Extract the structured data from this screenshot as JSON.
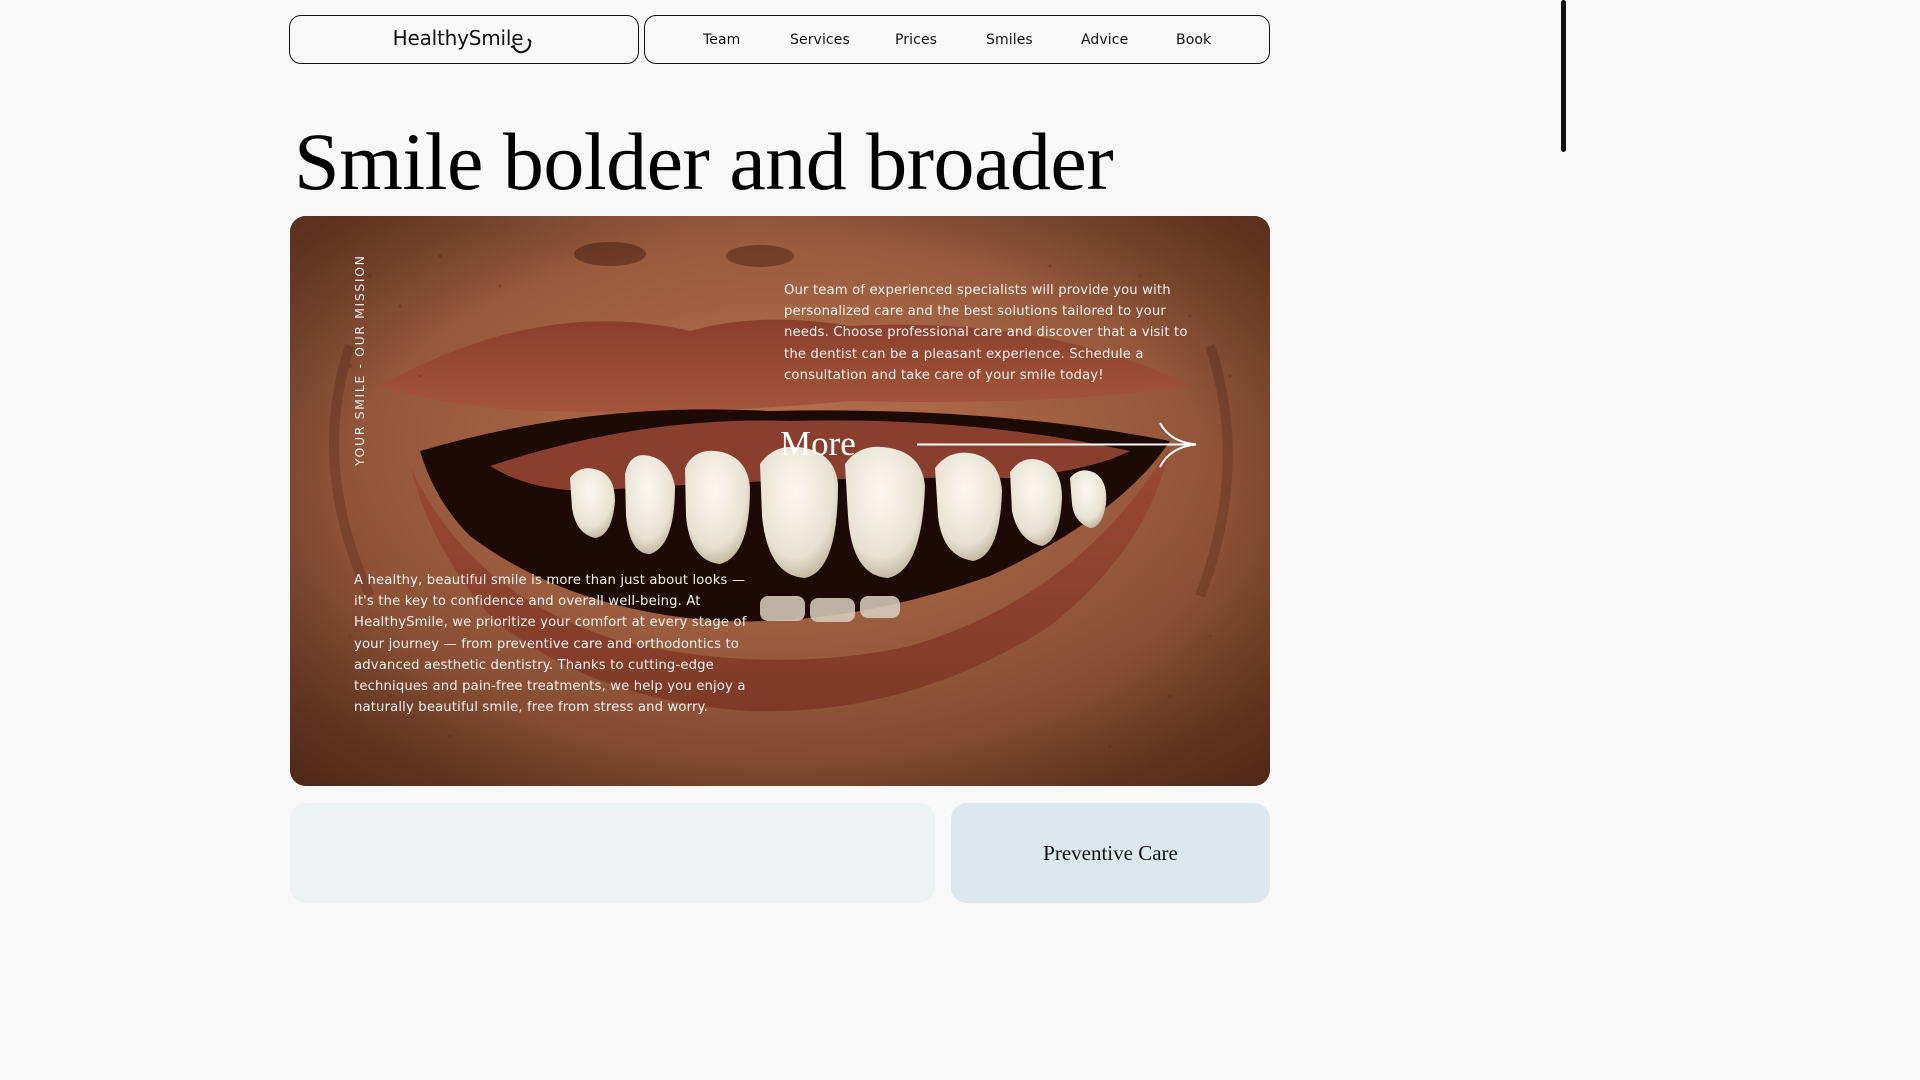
{
  "header": {
    "logo_text": "HealthySmile",
    "nav": [
      {
        "label": "Team"
      },
      {
        "label": "Services"
      },
      {
        "label": "Prices"
      },
      {
        "label": "Smiles"
      },
      {
        "label": "Advice"
      },
      {
        "label": "Book"
      }
    ]
  },
  "hero": {
    "title": "Smile bolder and broader",
    "mission_label": "YOUR SMILE - OUR MISSION",
    "text_right": "Our team of experienced specialists will provide you with personalized care and the best solutions tailored to your needs. Choose professional care and discover that a visit to the dentist can be a pleasant experience. Schedule a consultation and take care of your smile today!",
    "text_left": "A healthy, beautiful smile is more than just about looks — it's the key to confidence and overall well-being. At HealthySmile, we prioritize your comfort at every stage of your journey — from preventive care and orthodontics to advanced aesthetic dentistry. Thanks to cutting-edge techniques and pain-free treatments, we help you enjoy a naturally beautiful smile, free from stress and worry.",
    "more_label": "More",
    "image_subject": "smiling mouth close-up"
  },
  "cards": {
    "right_title": "Preventive Care"
  },
  "colors": {
    "background": "#f8f8f8",
    "text": "#111111",
    "card_left": "#eff2f3",
    "card_right": "#dde8ee",
    "skin": "#92553a"
  }
}
